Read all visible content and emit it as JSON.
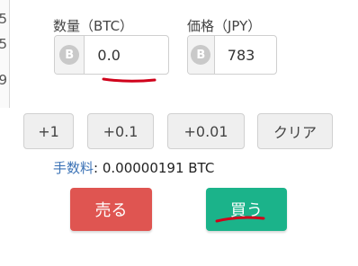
{
  "left_panel": {
    "rows": [
      "5",
      "5",
      "9"
    ]
  },
  "quantity": {
    "label": "数量（BTC）",
    "value": "0.0",
    "coin_symbol": "B"
  },
  "price": {
    "label": "価格（JPY）",
    "value": "783",
    "coin_symbol": "B"
  },
  "quick_buttons": [
    "+1",
    "+0.1",
    "+0.01",
    "クリア"
  ],
  "fee": {
    "label": "手数料",
    "value": ": 0.00000191 BTC"
  },
  "actions": {
    "sell": "売る",
    "buy": "買う"
  },
  "colors": {
    "sell": "#df5551",
    "buy": "#1bb38a",
    "fee_label": "#3c73b6",
    "annotation": "#d0021b"
  }
}
